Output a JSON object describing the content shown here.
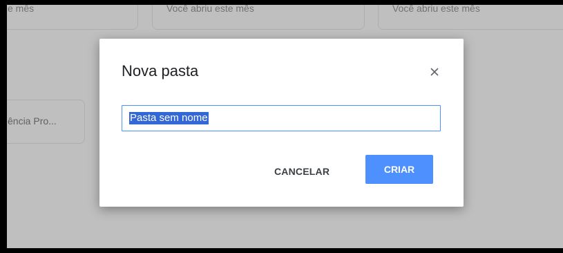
{
  "background": {
    "cards": [
      {
        "label": "e mês"
      },
      {
        "label": "Você abriu este mês"
      },
      {
        "label": "Você abriu este mês"
      }
    ],
    "folder_card": {
      "label": "ência Pro..."
    }
  },
  "dialog": {
    "title": "Nova pasta",
    "close_icon": "close-icon",
    "input_value": "Pasta sem nome",
    "cancel_label": "CANCELAR",
    "create_label": "CRIAR"
  },
  "colors": {
    "primary": "#4d90fe",
    "selection": "#3367d6",
    "overlay": "rgba(128,128,128,0.5)"
  }
}
